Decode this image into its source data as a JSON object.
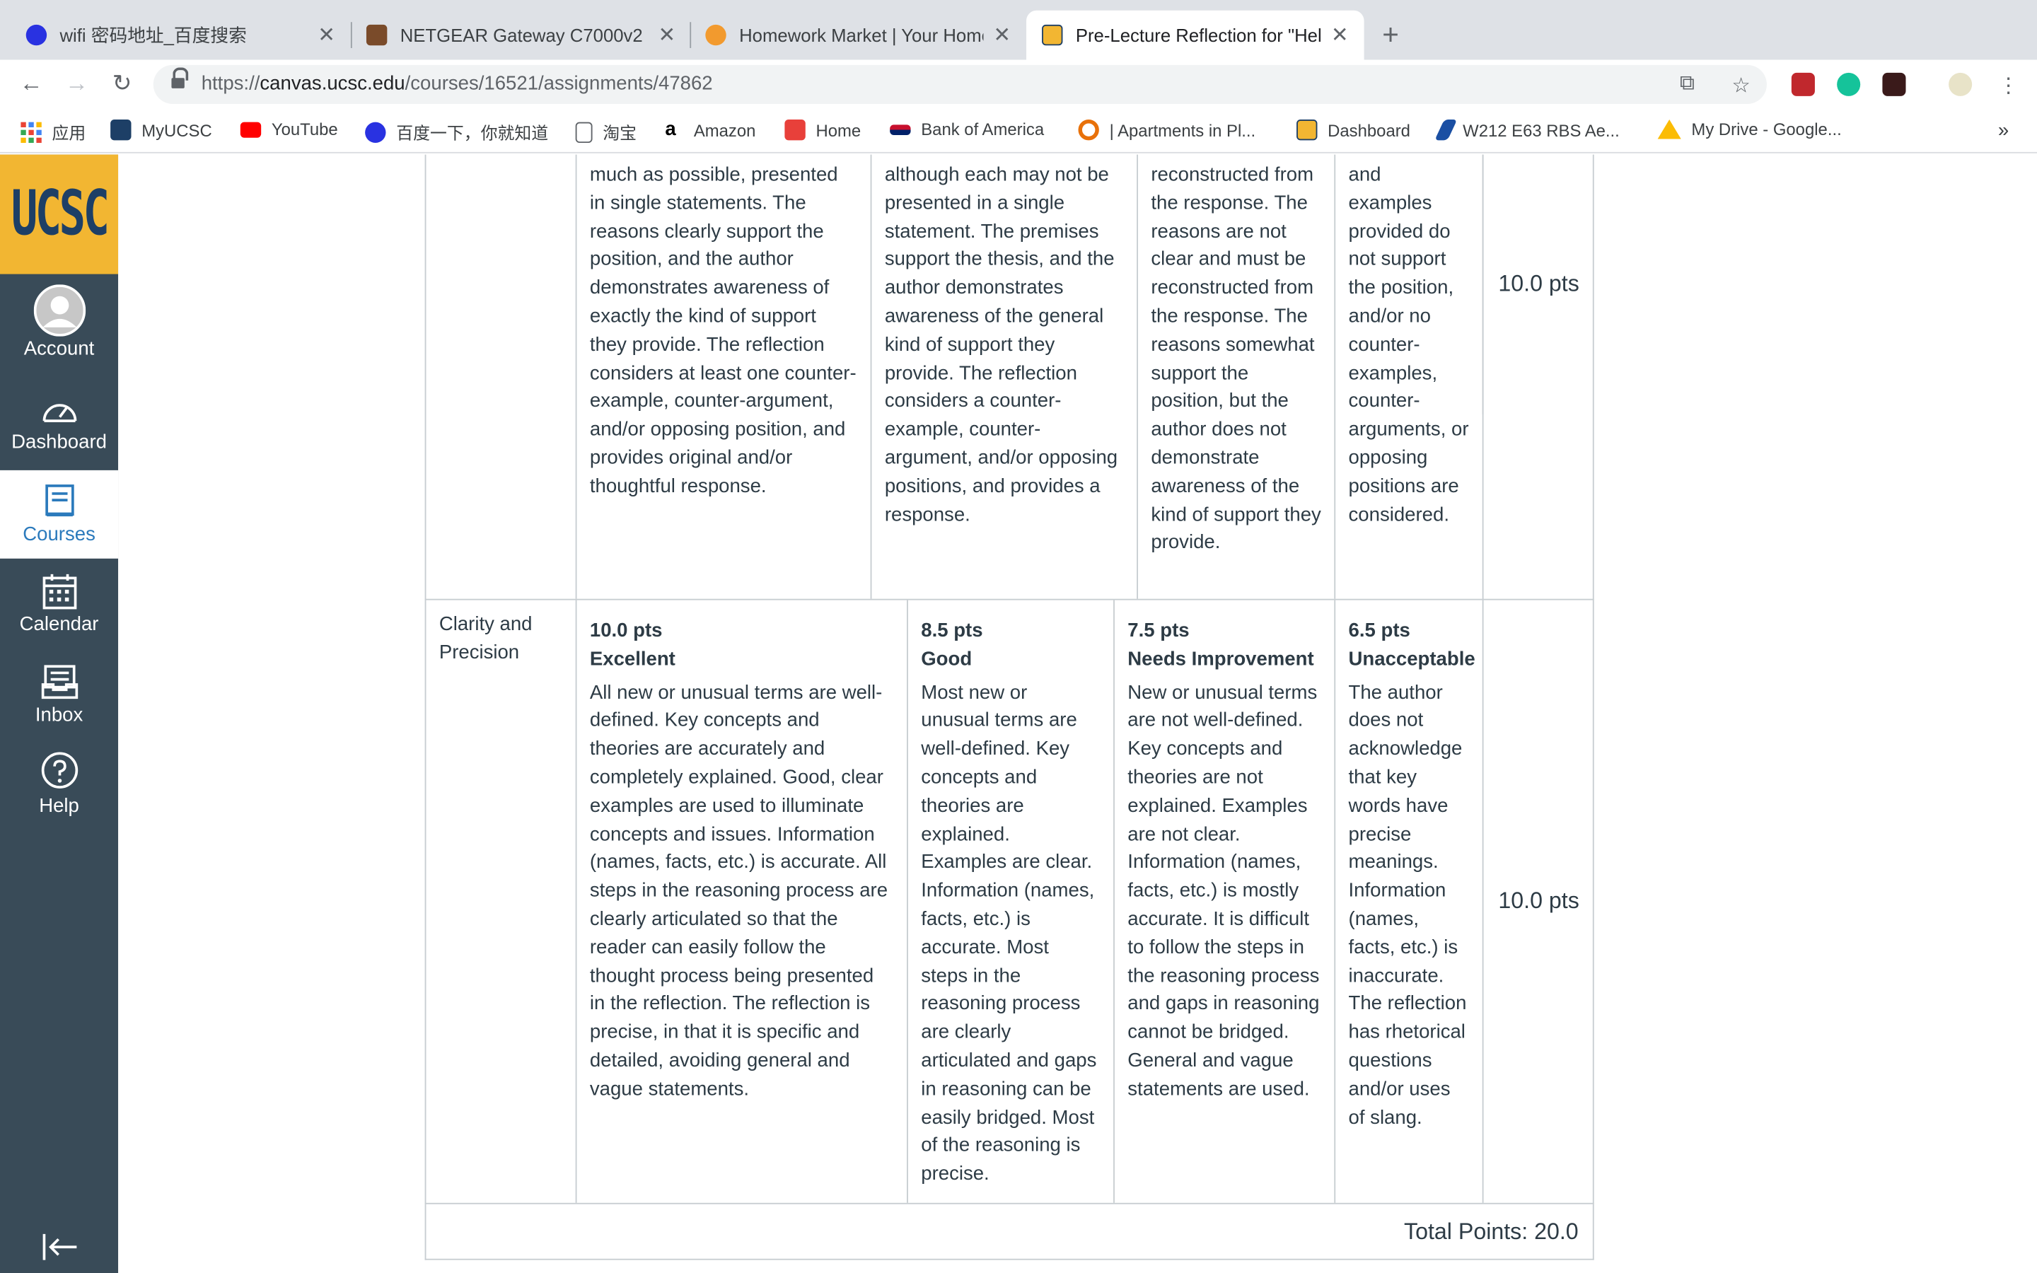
{
  "browser": {
    "tabs": [
      {
        "title": "wifi 密码地址_百度搜索",
        "favicon_color": "#2932e1"
      },
      {
        "title": "NETGEAR Gateway C7000v2",
        "favicon_color": "#7a4b2a"
      },
      {
        "title": "Homework Market | Your Home",
        "favicon_color": "#f29a2e"
      },
      {
        "title": "Pre-Lecture Reflection for \"Hel",
        "favicon_color": "#f2b632"
      }
    ],
    "url_scheme": "https://",
    "url_host": "canvas.ucsc.edu",
    "url_path": "/courses/16521/assignments/47862",
    "bookmarks": [
      {
        "label": "应用",
        "color": "#4285f4"
      },
      {
        "label": "MyUCSC",
        "color": "#1d3f66"
      },
      {
        "label": "YouTube",
        "color": "#ff0000"
      },
      {
        "label": "百度一下，你就知道",
        "color": "#2932e1"
      },
      {
        "label": "淘宝",
        "color": "#5f6368"
      },
      {
        "label": "Amazon",
        "color": "#000000"
      },
      {
        "label": "Home",
        "color": "#e8403a"
      },
      {
        "label": "Bank of America",
        "color": "#c8102e"
      },
      {
        "label": "| Apartments in Pl...",
        "color": "#e8710a"
      },
      {
        "label": "Dashboard",
        "color": "#f2b632"
      },
      {
        "label": "W212 E63 RBS Ae...",
        "color": "#1a4fa3"
      },
      {
        "label": "My Drive - Google...",
        "color": "#fbbc04"
      }
    ],
    "more_bookmarks": "»"
  },
  "sidenav": {
    "logo_text": "UCSC",
    "items": [
      {
        "label": "Account",
        "icon": "user-avatar-icon"
      },
      {
        "label": "Dashboard",
        "icon": "dashboard-gauge-icon"
      },
      {
        "label": "Courses",
        "icon": "courses-book-icon",
        "active": true
      },
      {
        "label": "Calendar",
        "icon": "calendar-icon"
      },
      {
        "label": "Inbox",
        "icon": "inbox-icon"
      },
      {
        "label": "Help",
        "icon": "help-icon"
      }
    ],
    "accent_color": "#2b7abc",
    "bg_color": "#394b58",
    "logo_bg": "#f2b632"
  },
  "rubric": {
    "row1": {
      "ratings": [
        {
          "description": "much as possible, presented in single statements. The reasons clearly support the position, and the author demonstrates awareness of exactly the kind of support they provide. The reflection considers at least one counter-example, counter-argument, and/or opposing position, and provides original and/or thoughtful response."
        },
        {
          "description": "although each may not be presented in a single statement. The premises support the thesis, and the author demonstrates awareness of the general kind of support they provide. The reflection considers a counter-example, counter-argument, and/or opposing positions, and provides a response."
        },
        {
          "description": "reconstructed from the response. The reasons are not clear and must be reconstructed from the response. The reasons somewhat support the position, but the author does not demonstrate awareness of the kind of support they provide."
        },
        {
          "description": "and examples provided do not support the position, and/or no counter-examples, counter-arguments, or opposing positions are considered."
        }
      ],
      "points": "10.0 pts"
    },
    "row2": {
      "criterion": "Clarity and Precision",
      "ratings": [
        {
          "points": "10.0 pts",
          "title": "Excellent",
          "description": "All new or unusual terms are well-defined. Key concepts and theories are accurately and completely explained. Good, clear examples are used to illuminate concepts and issues. Information (names, facts, etc.) is accurate. All steps in the reasoning process are clearly articulated so that the reader can easily follow the thought process being presented in the reflection. The reflection is precise, in that it is specific and detailed, avoiding general and vague statements."
        },
        {
          "points": "8.5 pts",
          "title": "Good",
          "description": "Most new or unusual terms are well-defined. Key concepts and theories are explained. Examples are clear. Information (names, facts, etc.) is accurate. Most steps in the reasoning process are clearly articulated and gaps in reasoning can be easily bridged. Most of the reasoning is precise."
        },
        {
          "points": "7.5 pts",
          "title": "Needs Improvement",
          "description": "New or unusual terms are not well-defined. Key concepts and theories are not explained. Examples are not clear. Information (names, facts, etc.) is mostly accurate. It is difficult to follow the steps in the reasoning process and gaps in reasoning cannot be bridged. General and vague statements are used."
        },
        {
          "points": "6.5 pts",
          "title": "Unacceptable",
          "description": "The author does not acknowledge that key words have precise meanings. Information (names, facts, etc.) is inaccurate. The reflection has rhetorical questions and/or uses of slang."
        }
      ],
      "points": "10.0 pts"
    },
    "total": "Total Points: 20.0"
  }
}
